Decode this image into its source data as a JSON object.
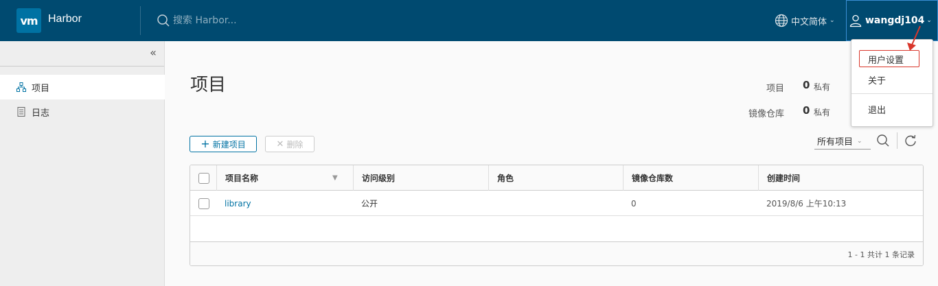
{
  "header": {
    "logo_text": "vm",
    "brand": "Harbor",
    "search_placeholder": "搜索 Harbor...",
    "language": "中文简体",
    "username": "wangdj104"
  },
  "sidebar": {
    "items": [
      {
        "label": "项目",
        "icon": "projects-icon",
        "active": true
      },
      {
        "label": "日志",
        "icon": "logs-icon",
        "active": false
      }
    ]
  },
  "main": {
    "title": "项目",
    "summary": [
      {
        "label": "项目",
        "count": "0",
        "sub": "私有"
      },
      {
        "label": "镜像仓库",
        "count": "0",
        "sub": "私有"
      }
    ],
    "new_button": "新建项目",
    "delete_button": "删除",
    "filter_value": "所有项目"
  },
  "grid": {
    "columns": [
      "项目名称",
      "访问级别",
      "角色",
      "镜像仓库数",
      "创建时间"
    ],
    "rows": [
      {
        "name": "library",
        "access": "公开",
        "role": "",
        "repo_count": "0",
        "created": "2019/8/6 上午10:13"
      }
    ],
    "footer": "1 - 1 共计 1 条记录"
  },
  "user_menu": {
    "items": [
      "用户设置",
      "关于",
      "退出"
    ]
  },
  "colors": {
    "header_bg": "#004a70",
    "accent": "#0072a3",
    "highlight_red": "#d9362b"
  }
}
